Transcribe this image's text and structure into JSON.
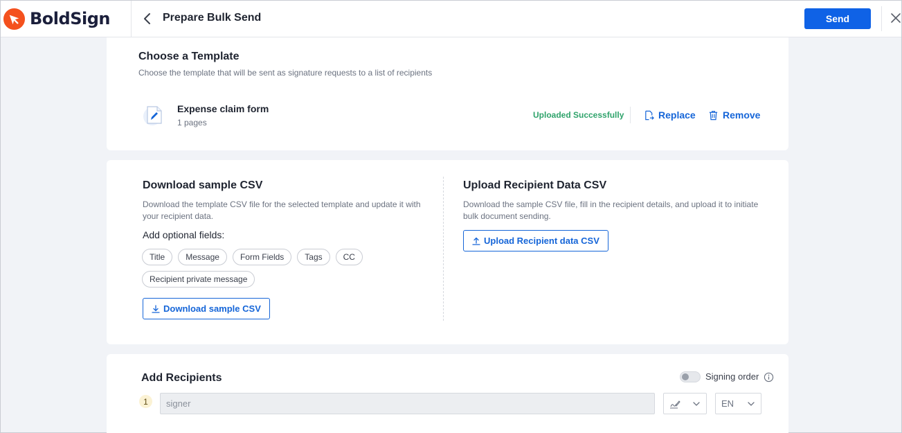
{
  "header": {
    "brand": "BoldSign",
    "title": "Prepare Bulk Send",
    "send_label": "Send"
  },
  "template_section": {
    "title": "Choose a Template",
    "description": "Choose the template that will be sent as signature requests to a list of recipients",
    "document": {
      "name": "Expense claim form",
      "pages": "1 pages"
    },
    "status": "Uploaded Successfully",
    "replace_label": "Replace",
    "remove_label": "Remove"
  },
  "csv_section": {
    "download": {
      "title": "Download sample CSV",
      "description": "Download the template CSV file for the selected template and update it with your recipient data.",
      "optional_label": "Add optional fields:",
      "chips": [
        "Title",
        "Message",
        "Form Fields",
        "Tags",
        "CC",
        "Recipient private message"
      ],
      "button_label": "Download sample CSV"
    },
    "upload": {
      "title": "Upload Recipient Data CSV",
      "description": "Download the sample CSV file, fill in the recipient details, and upload it to initiate bulk document sending.",
      "button_label": "Upload Recipient data CSV"
    }
  },
  "recipients_section": {
    "title": "Add Recipients",
    "signing_order_label": "Signing order",
    "signing_order_enabled": false,
    "recipient": {
      "number": "1",
      "placeholder": "signer",
      "language": "EN"
    }
  },
  "colors": {
    "primary": "#0f62e6",
    "link": "#1565d8",
    "success": "#2fa36b",
    "brand_orange": "#f4511e"
  }
}
